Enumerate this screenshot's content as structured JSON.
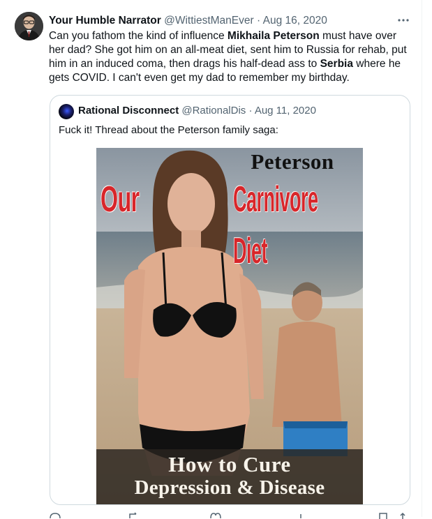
{
  "tweet": {
    "author_name": "Your Humble Narrator",
    "author_handle": "@WittiestManEver",
    "separator": "·",
    "date": "Aug 16, 2020",
    "more_icon": "more-horizontal-icon",
    "text_parts": [
      "Can you fathom the kind of influence ",
      "Mikhaila Peterson",
      " must have over her dad? She got him on an all-meat diet, sent him to Russia for rehab, put him in an induced coma, then drags his half-dead ass to ",
      "Serbia",
      " where he gets COVID. I can't even get my dad to remember my birthday."
    ]
  },
  "quote": {
    "author_name": "Rational Disconnect",
    "author_handle": "@RationalDis",
    "separator": "·",
    "date": "Aug 11, 2020",
    "text": "Fuck it! Thread about the Peterson family saga:",
    "media": {
      "top_title": "Peterson",
      "word_our": "Our",
      "word_carnivore": "Carnivore",
      "word_diet": "Diet",
      "bottom_line1": "How to Cure",
      "bottom_line2": "Depression & Disease"
    }
  },
  "actions": [
    "reply-icon",
    "retweet-icon",
    "like-icon",
    "views-icon",
    "bookmark-icon",
    "share-icon"
  ]
}
